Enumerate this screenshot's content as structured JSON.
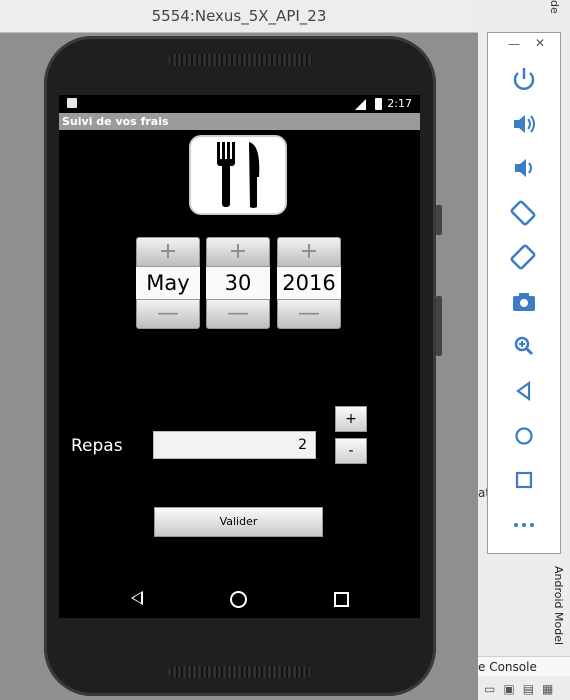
{
  "emulator": {
    "title": "5554:Nexus_5X_API_23"
  },
  "device": {
    "status_time": "2:17",
    "app_title": "Suivi de vos frais"
  },
  "date_picker": {
    "plus_label": "+",
    "minus_label": "—",
    "month": "May",
    "day": "30",
    "year": "2016"
  },
  "form": {
    "label": "Repas",
    "quantity": "2",
    "plus_button": "+",
    "minus_button": "-",
    "validate_label": "Valider"
  },
  "side_panel": {
    "minimize": "—",
    "close": "✕",
    "buttons": [
      "power-icon",
      "volume-up-icon",
      "volume-down-icon",
      "rotate-left-icon",
      "rotate-right-icon",
      "camera-icon",
      "zoom-icon",
      "back-icon",
      "home-icon",
      "overview-icon",
      "more-icon"
    ]
  },
  "ide": {
    "console_label": "e Console",
    "android_model_label": "Android Model",
    "top_right_fragment": "de",
    "snippet": "at"
  },
  "colors": {
    "icon_blue": "#3c7dc4",
    "action_bar": "#9b9b9b"
  }
}
